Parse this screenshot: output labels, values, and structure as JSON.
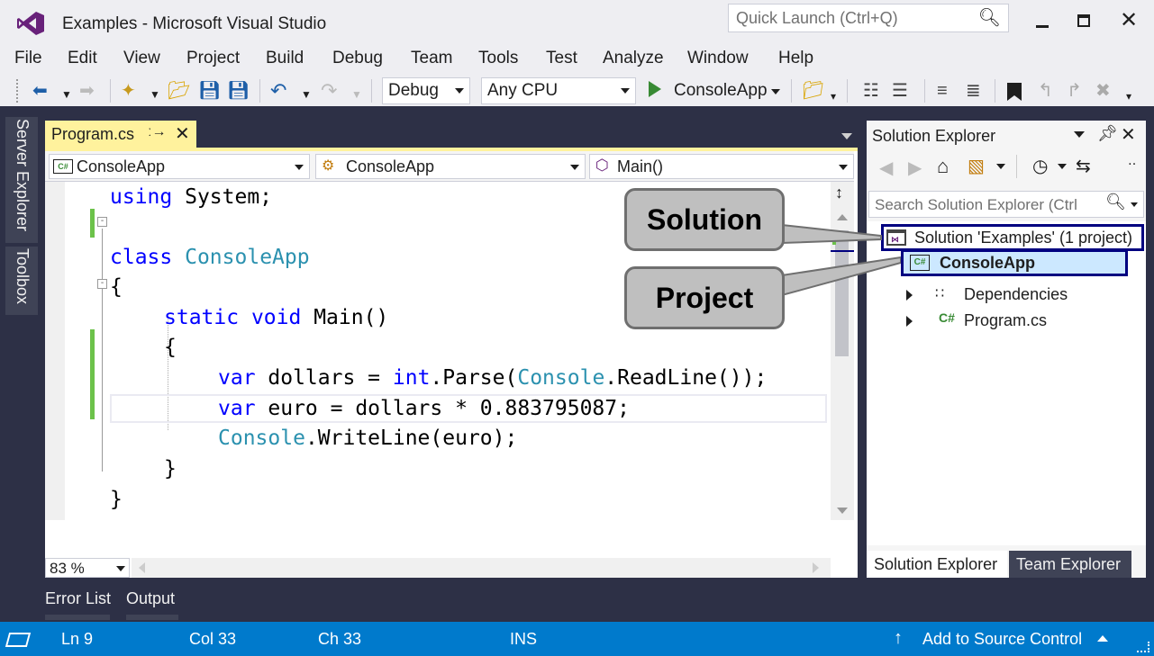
{
  "window": {
    "title": "Examples - Microsoft Visual Studio"
  },
  "quick_launch": {
    "placeholder": "Quick Launch (Ctrl+Q)"
  },
  "menu": [
    "File",
    "Edit",
    "View",
    "Project",
    "Build",
    "Debug",
    "Team",
    "Tools",
    "Test",
    "Analyze",
    "Window",
    "Help"
  ],
  "toolbar": {
    "configuration": "Debug",
    "platform": "Any CPU",
    "start_label": "ConsoleApp"
  },
  "side_tabs": [
    "Server Explorer",
    "Toolbox"
  ],
  "editor": {
    "tab_label": "Program.cs",
    "nav_project": "ConsoleApp",
    "nav_class": "ConsoleApp",
    "nav_member": "Main()",
    "zoom": "83 %",
    "code": {
      "l1_kw": "using",
      "l1_rest": " System;",
      "l3_kw": "class",
      "l3_type": "ConsoleApp",
      "l4": "{",
      "l5_kw1": "static",
      "l5_kw2": "void",
      "l5_rest": " Main()",
      "l6": "{",
      "l7_kw": "var",
      "l7_mid": " dollars = ",
      "l7_kw2": "int",
      "l7_mid2": ".Parse(",
      "l7_type": "Console",
      "l7_end": ".ReadLine());",
      "l8_kw": "var",
      "l8_rest": " euro = dollars * 0.883795087;",
      "l9_type": "Console",
      "l9_rest": ".WriteLine(euro);",
      "l10": "}",
      "l11": "}"
    }
  },
  "solution_explorer": {
    "title": "Solution Explorer",
    "search_placeholder": "Search Solution Explorer (Ctrl",
    "items": {
      "solution": "Solution 'Examples' (1 project)",
      "project": "ConsoleApp",
      "dependencies": "Dependencies",
      "program": "Program.cs"
    },
    "bottom_tabs": [
      "Solution Explorer",
      "Team Explorer"
    ]
  },
  "callouts": {
    "solution": "Solution",
    "project": "Project"
  },
  "bottom_panel_tabs": [
    "Error List",
    "Output"
  ],
  "status": {
    "ln": "Ln 9",
    "col": "Col 33",
    "ch": "Ch 33",
    "mode": "INS",
    "source_control": "Add to Source Control"
  },
  "colors": {
    "accent": "#007acc",
    "vs_purple": "#68217a",
    "tab_active": "#fff29d",
    "callout_fill": "#bfbfbf",
    "highlight_border": "#000080"
  }
}
